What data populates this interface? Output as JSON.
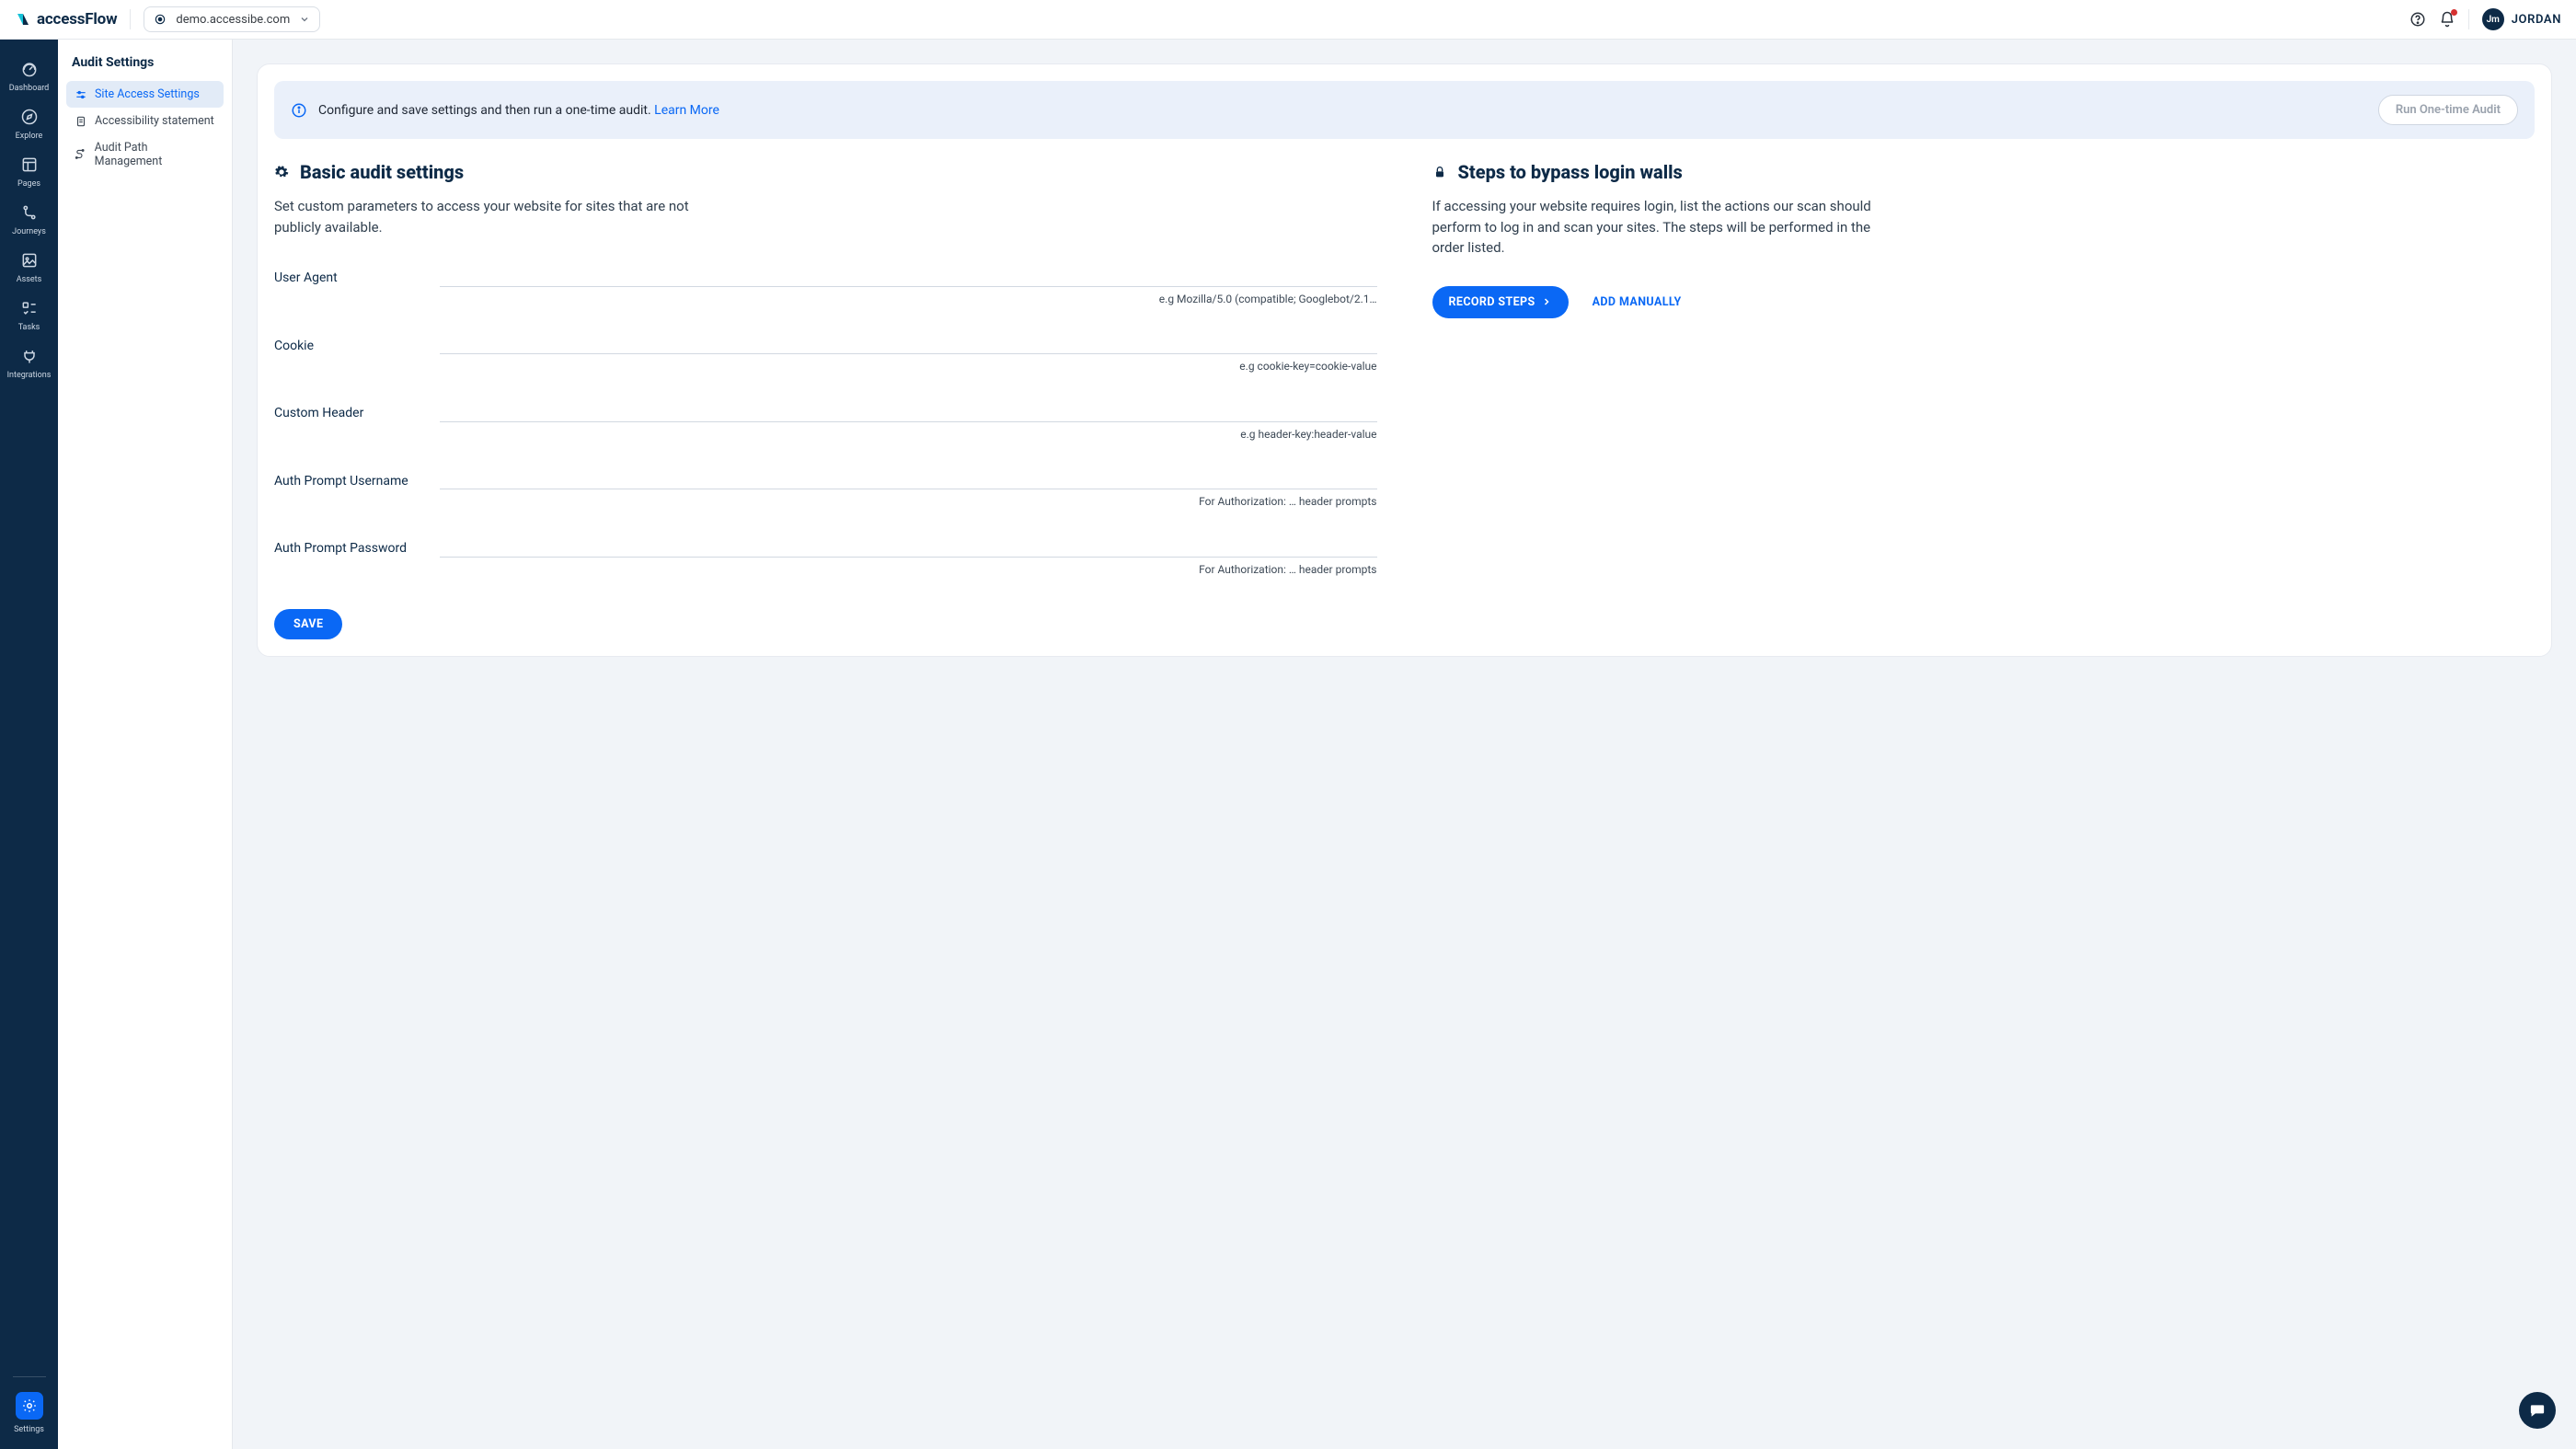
{
  "header": {
    "app_name": "accessFlow",
    "site": "demo.accessibe.com",
    "user_initials": "Jm",
    "user_name": "JORDAN"
  },
  "rail": {
    "items": [
      {
        "label": "Dashboard"
      },
      {
        "label": "Explore"
      },
      {
        "label": "Pages"
      },
      {
        "label": "Journeys"
      },
      {
        "label": "Assets"
      },
      {
        "label": "Tasks"
      },
      {
        "label": "Integrations"
      }
    ],
    "settings_label": "Settings"
  },
  "sidebar": {
    "title": "Audit Settings",
    "items": [
      {
        "label": "Site Access Settings"
      },
      {
        "label": "Accessibility statement"
      },
      {
        "label": "Audit Path Management"
      }
    ]
  },
  "main": {
    "banner_text": "Configure and save settings and then run a one-time audit. ",
    "banner_link": "Learn More",
    "run_audit": "Run One-time Audit",
    "basic": {
      "title": "Basic audit settings",
      "desc": "Set custom parameters to access your website for sites that are not publicly available.",
      "fields": [
        {
          "label": "User Agent",
          "hint": "e.g Mozilla/5.0 (compatible; Googlebot/2.1…"
        },
        {
          "label": "Cookie",
          "hint": "e.g cookie-key=cookie-value"
        },
        {
          "label": "Custom Header",
          "hint": "e.g header-key:header-value"
        },
        {
          "label": "Auth Prompt Username",
          "hint": "For Authorization: … header prompts"
        },
        {
          "label": "Auth Prompt Password",
          "hint": "For Authorization: … header prompts"
        }
      ],
      "save": "SAVE"
    },
    "steps": {
      "title": "Steps to bypass login walls",
      "desc": "If accessing your website requires login, list the actions our scan should perform to log in and scan your sites. The steps will be performed in the order listed.",
      "record": "RECORD STEPS",
      "add": "ADD MANUALLY"
    }
  }
}
